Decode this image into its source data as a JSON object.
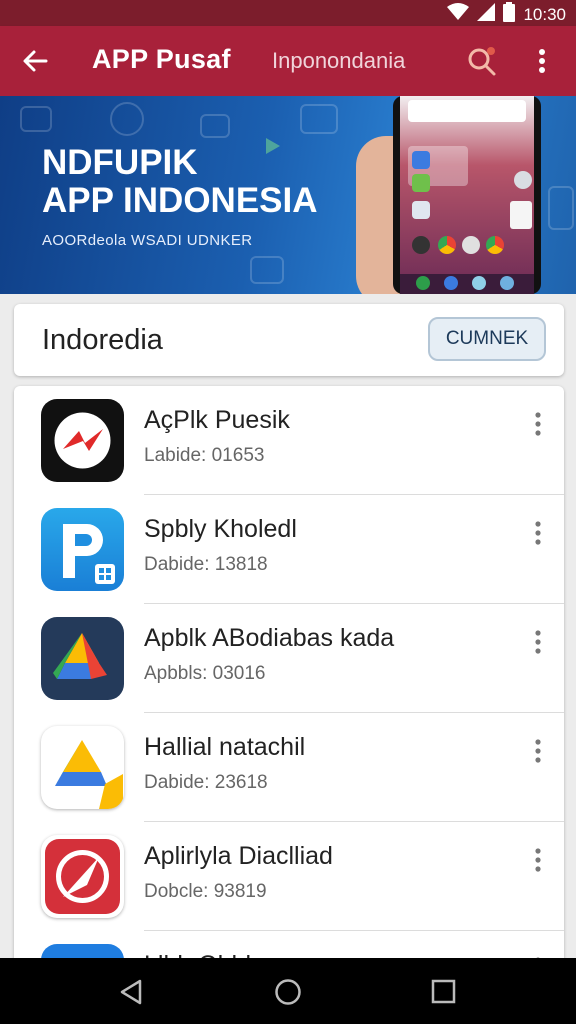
{
  "status_bar": {
    "time": "10:30"
  },
  "app_bar": {
    "title": "APP Pusaf",
    "subtitle": "Inponondania"
  },
  "banner": {
    "headline_line1": "NDFUPIK",
    "headline_line2": "APP INDONESIA",
    "tagline": "AOORdeola WSADI UDNKER"
  },
  "category": {
    "name": "Indoredia",
    "button_label": "CUMNEK"
  },
  "apps": [
    {
      "name": "AçPlk Puesik",
      "sub": "Labide: 01653",
      "icon": "red-bolt-app-icon"
    },
    {
      "name": "Spbly Kholedl",
      "sub": "Dabide: 13818",
      "icon": "blue-p-app-icon"
    },
    {
      "name": "Apblk ABodiabas kada",
      "sub": "Apbbls: 03016",
      "icon": "drive-triangle-dark-icon"
    },
    {
      "name": "Hallial natachil",
      "sub": "Dabide: 23618",
      "icon": "drive-triangle-light-icon"
    },
    {
      "name": "Aplirlyla Diaclliad",
      "sub": "Dobcle: 93819",
      "icon": "red-compass-app-icon"
    },
    {
      "name": "Llhb Ohhl",
      "sub": "",
      "icon": "blue-app-icon"
    }
  ],
  "colors": {
    "primary": "#a8213a",
    "status_bar": "#7c1d2c",
    "banner": "#1b5fb0"
  }
}
